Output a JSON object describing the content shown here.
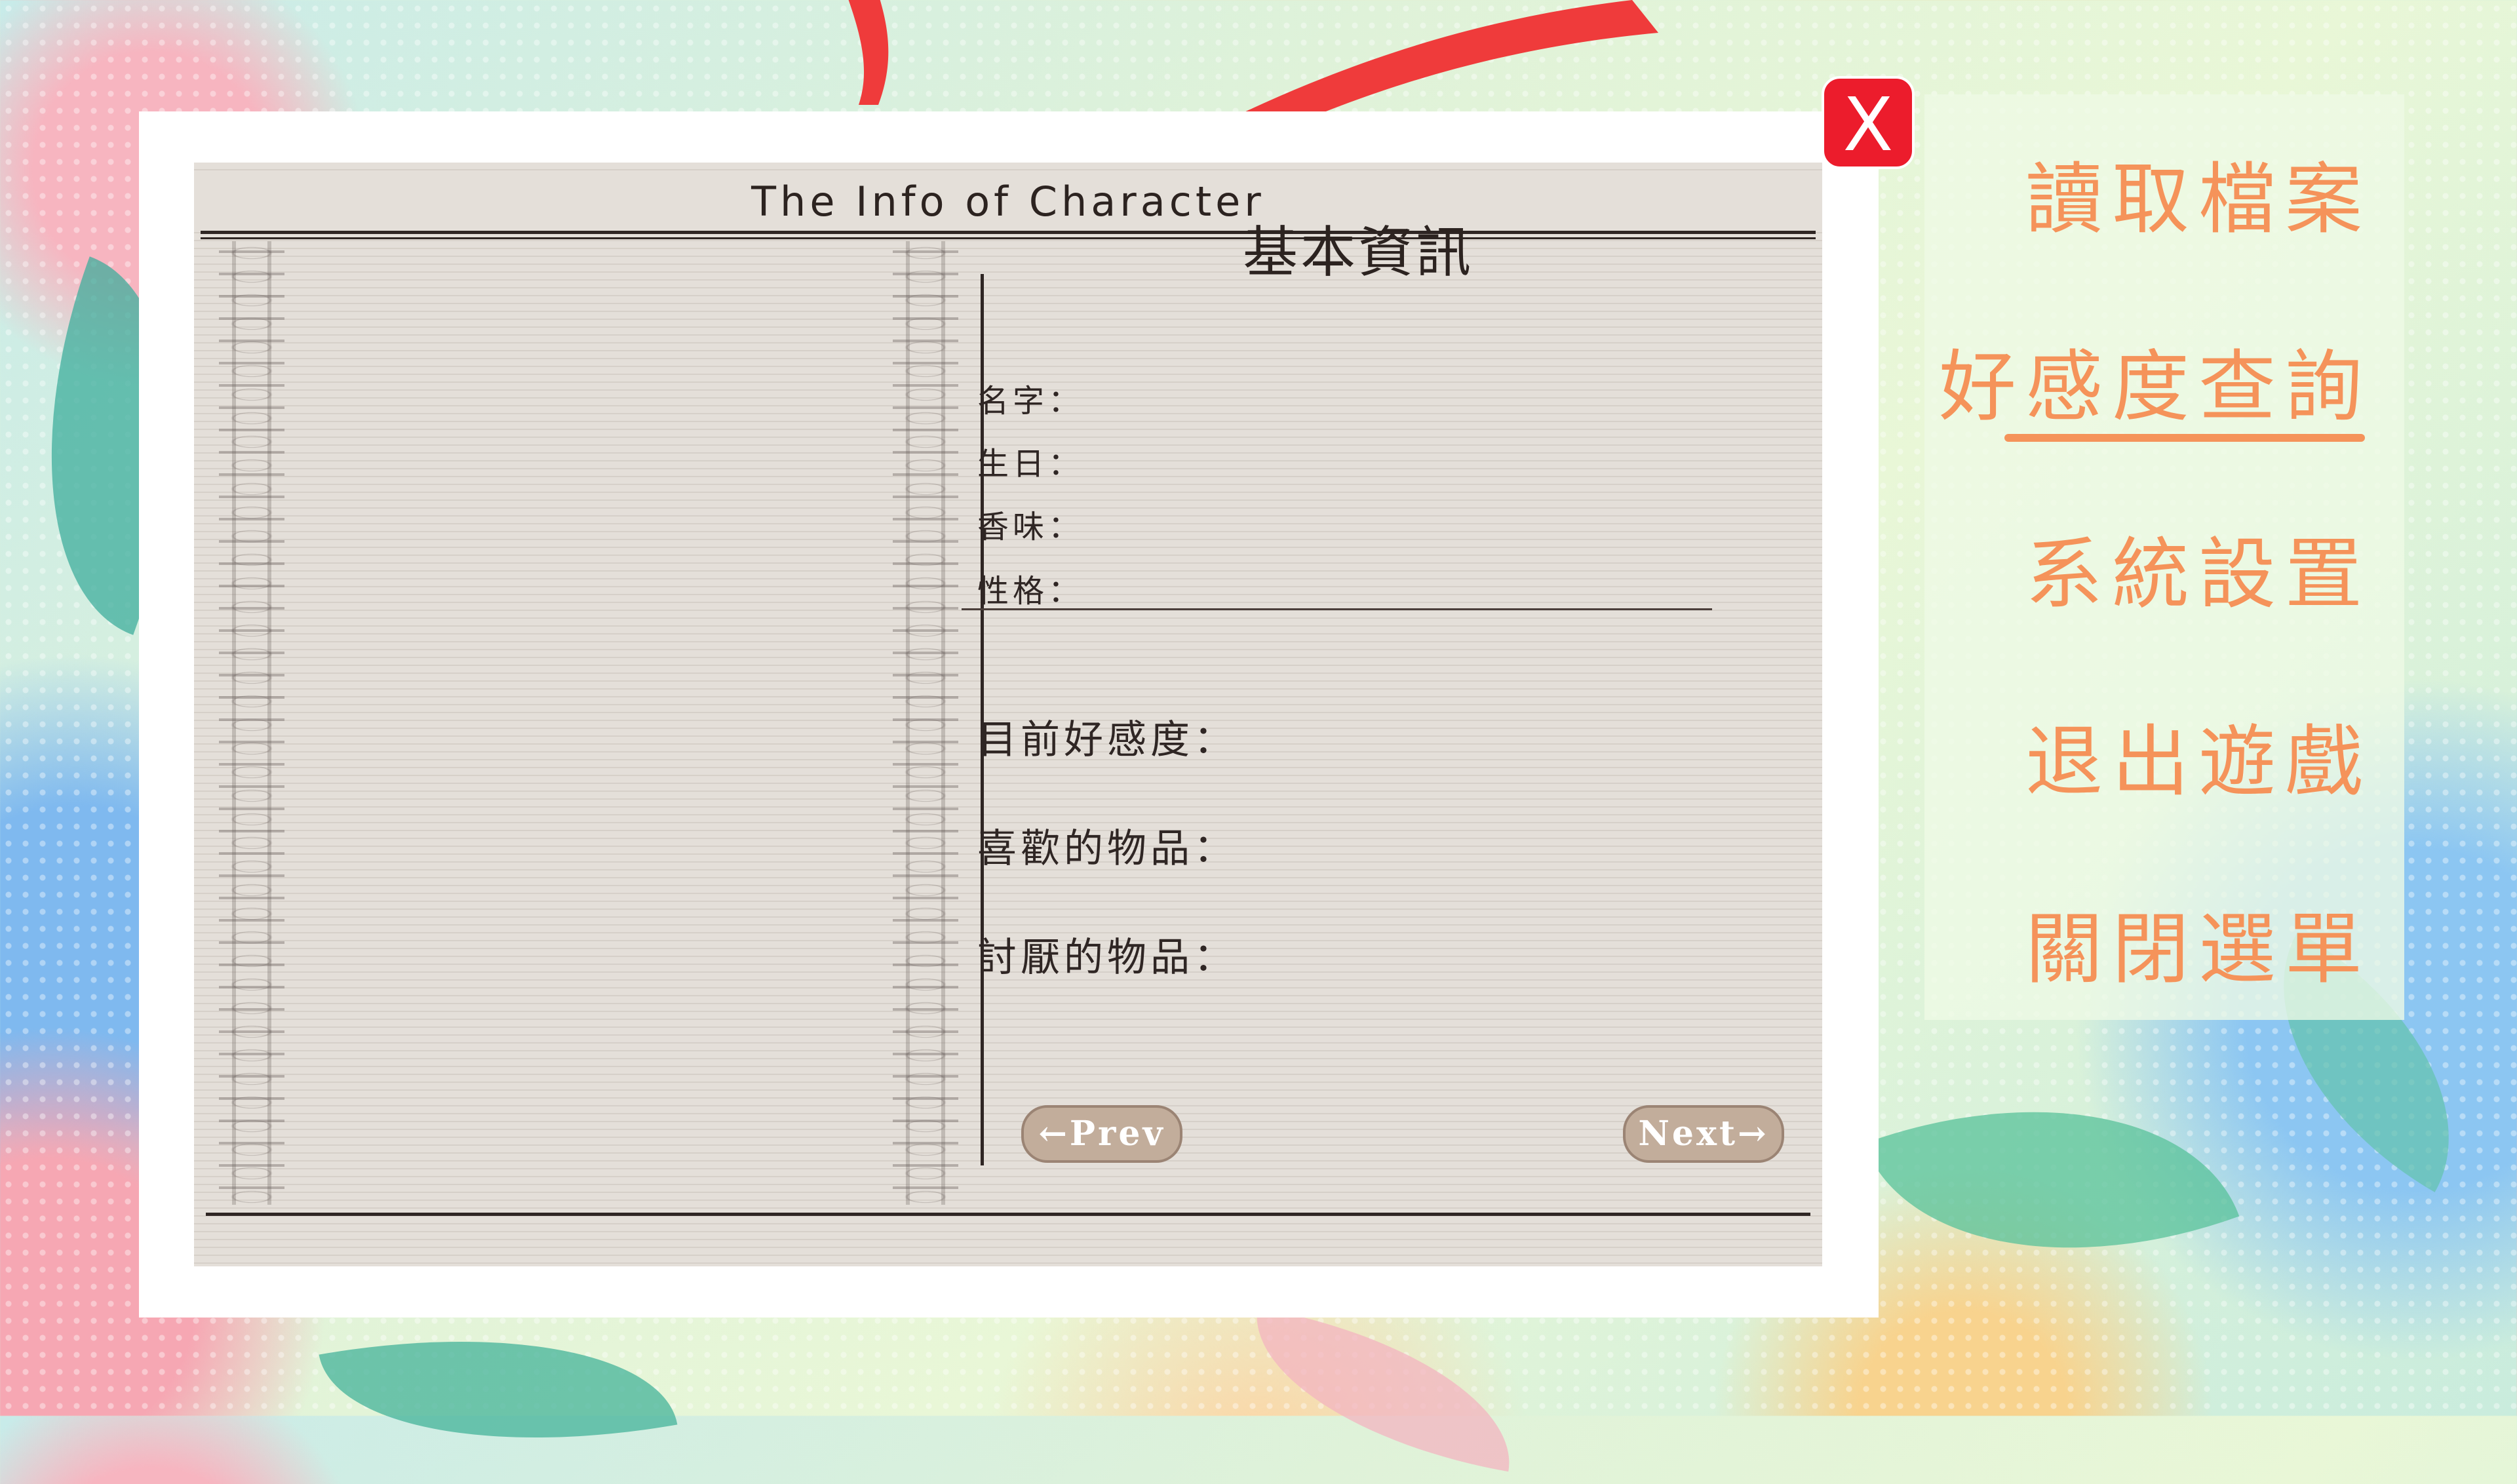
{
  "panel": {
    "header_title": "The Info of Character",
    "section_title": "基本資訊",
    "fields": [
      {
        "label": "名字："
      },
      {
        "label": "生日："
      },
      {
        "label": "香味："
      },
      {
        "label": "性格："
      }
    ],
    "stats": [
      {
        "label": "目前好感度："
      },
      {
        "label": "喜歡的物品："
      },
      {
        "label": "討厭的物品："
      }
    ],
    "prev_label": "←Prev",
    "next_label": "Next→"
  },
  "close_label": "X",
  "menu": {
    "items": [
      {
        "label": "讀取檔案",
        "active": false
      },
      {
        "label": "好感度查詢",
        "active": true
      },
      {
        "label": "系統設置",
        "active": false
      },
      {
        "label": "退出遊戲",
        "active": false
      },
      {
        "label": "關閉選單",
        "active": false
      }
    ],
    "accent_color": "#f5935a"
  },
  "colors": {
    "close_button": "#ec1c2c",
    "pill_button": "#c2ad9b",
    "paper": "#e4dfd9"
  }
}
